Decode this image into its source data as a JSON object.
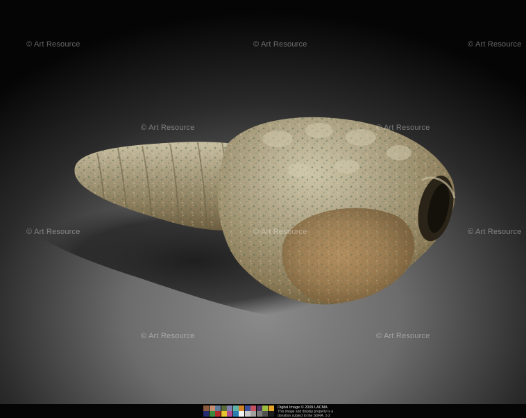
{
  "watermark": {
    "text": "© Art Resource",
    "color": "#ffffff"
  },
  "footer": {
    "credit_line1": "Digital Image © 2009 LACMA",
    "credit_line2": "This image and display property is a donation subject to the SGRA. 1-2 pattern authorized by the unidentified color profile.",
    "color_swatches": [
      "#8a5a3c",
      "#c58e73",
      "#5f7a9a",
      "#5a6b3a",
      "#7f80b0",
      "#5fb3a7",
      "#d38327",
      "#3c4f9a",
      "#c45060",
      "#4f3568",
      "#9bbf3c",
      "#e3a42a",
      "#25296e",
      "#3b8a3c",
      "#b02a2c",
      "#e6c52e",
      "#b04c8c",
      "#2a7fb0",
      "#f2f2f2",
      "#c8c8c8",
      "#a0a0a0",
      "#787878",
      "#505050",
      "#1e1e1e"
    ]
  },
  "photo": {
    "subject": "stone-shell-sculpture",
    "background_color": "#6a6a6a",
    "stone_color": "#a19776"
  }
}
